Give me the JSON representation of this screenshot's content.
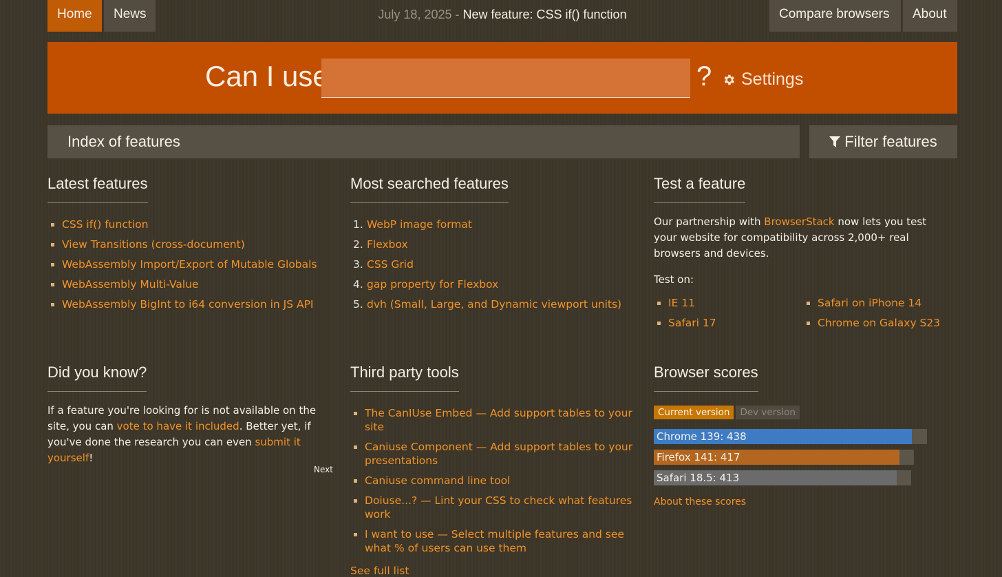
{
  "nav": {
    "home": "Home",
    "news": "News",
    "compare": "Compare browsers",
    "about": "About",
    "news_date": "July 18, 2025 - ",
    "news_title": "New feature: CSS if() function"
  },
  "hero": {
    "label": "Can I use",
    "input_value": "",
    "question": "?",
    "settings": "Settings"
  },
  "index_bar": {
    "title": "Index of features",
    "filter": "Filter features"
  },
  "latest": {
    "title": "Latest features",
    "items": [
      "CSS if() function",
      "View Transitions (cross-document)",
      "WebAssembly Import/Export of Mutable Globals",
      "WebAssembly Multi-Value",
      "WebAssembly BigInt to i64 conversion in JS API"
    ]
  },
  "most_searched": {
    "title": "Most searched features",
    "items": [
      "WebP image format",
      "Flexbox",
      "CSS Grid",
      "gap property for Flexbox",
      "dvh (Small, Large, and Dynamic viewport units)"
    ]
  },
  "test": {
    "title": "Test a feature",
    "text_before": "Our partnership with ",
    "link": "BrowserStack",
    "text_after": " now lets you test your website for compatibility across 2,000+ real browsers and devices.",
    "test_on": "Test on:",
    "targets": [
      "IE 11",
      "Safari on iPhone 14",
      "Safari 17",
      "Chrome on Galaxy S23"
    ]
  },
  "did_you_know": {
    "title": "Did you know?",
    "t1": "If a feature you're looking for is not available on the site, you can ",
    "l1": "vote to have it included",
    "t2": ". Better yet, if you've done the research you can even ",
    "l2": "submit it yourself",
    "t3": "!",
    "next": "Next"
  },
  "third_party": {
    "title": "Third party tools",
    "items": [
      "The CanIUse Embed — Add support tables to your site",
      "Caniuse Component — Add support tables to your presentations",
      "Caniuse command line tool",
      "Doiuse...? — Lint your CSS to check what features work",
      "I want to use — Select multiple features and see what % of users can use them"
    ],
    "see_full": "See full list"
  },
  "scores": {
    "title": "Browser scores",
    "tab_current": "Current version",
    "tab_dev": "Dev version",
    "bars": [
      {
        "label": "Chrome 139: 438",
        "value": 438,
        "color": "#3d7cc4"
      },
      {
        "label": "Firefox 141: 417",
        "value": 417,
        "color": "#b3661f"
      },
      {
        "label": "Safari 18.5: 413",
        "value": 413,
        "color": "#6b6b6b"
      }
    ],
    "about": "About these scores"
  },
  "colors": {
    "accent": "#c24f00",
    "link": "#f0932a"
  }
}
